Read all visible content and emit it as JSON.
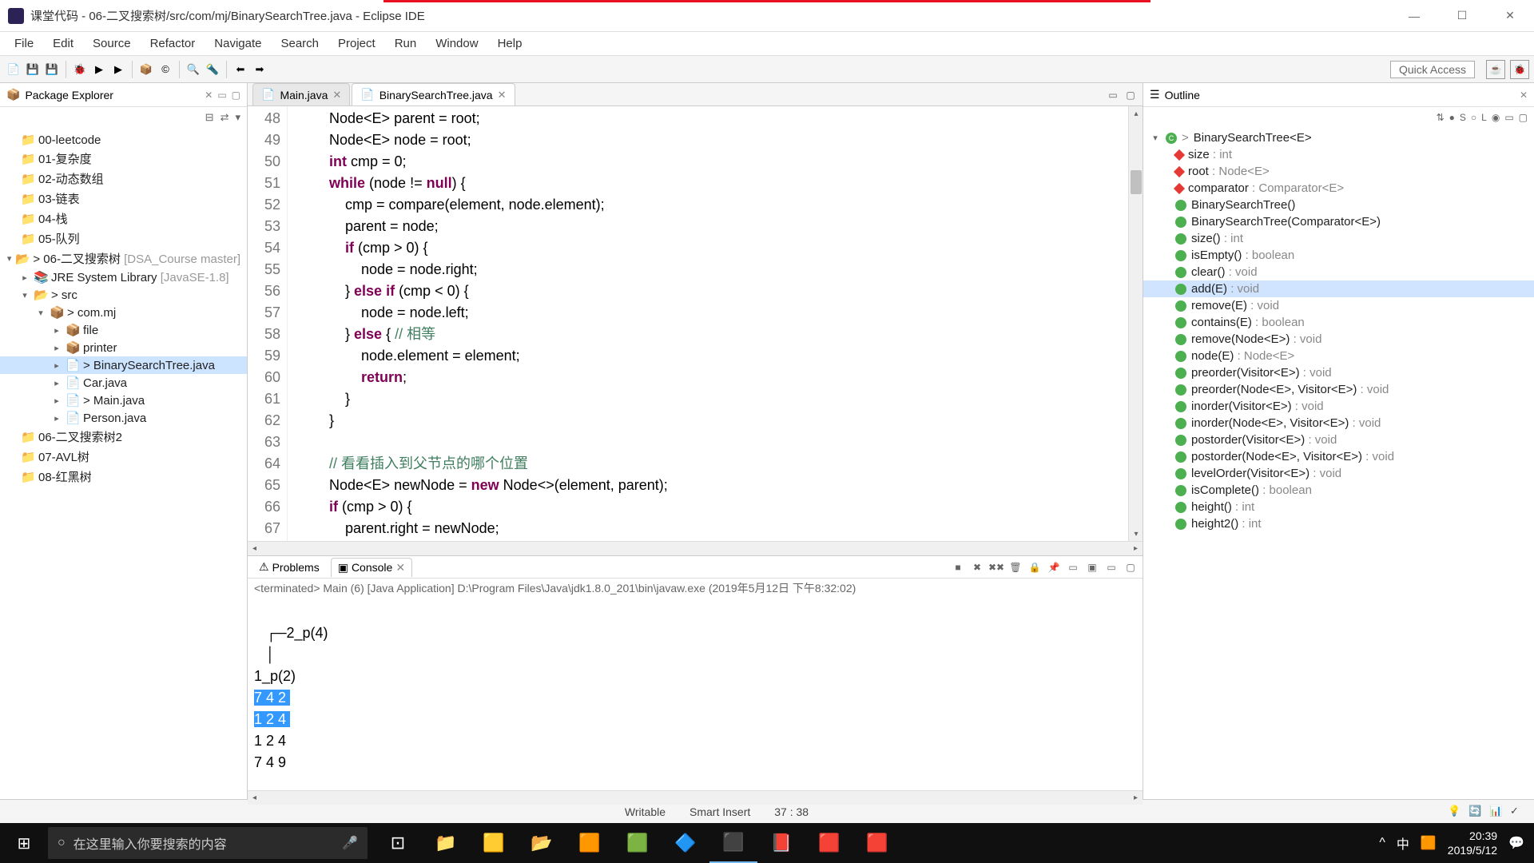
{
  "window": {
    "title": "课堂代码 - 06-二叉搜索树/src/com/mj/BinarySearchTree.java - Eclipse IDE"
  },
  "menu": [
    "File",
    "Edit",
    "Source",
    "Refactor",
    "Navigate",
    "Search",
    "Project",
    "Run",
    "Window",
    "Help"
  ],
  "quickAccess": "Quick Access",
  "packageExplorer": {
    "title": "Package Explorer",
    "items": [
      {
        "label": "00-leetcode",
        "indent": 0,
        "icon": "📁",
        "arrow": ""
      },
      {
        "label": "01-复杂度",
        "indent": 0,
        "icon": "📁",
        "arrow": ""
      },
      {
        "label": "02-动态数组",
        "indent": 0,
        "icon": "📁",
        "arrow": ""
      },
      {
        "label": "03-链表",
        "indent": 0,
        "icon": "📁",
        "arrow": ""
      },
      {
        "label": "04-栈",
        "indent": 0,
        "icon": "📁",
        "arrow": ""
      },
      {
        "label": "05-队列",
        "indent": 0,
        "icon": "📁",
        "arrow": ""
      },
      {
        "label": "> 06-二叉搜索树",
        "suffix": " [DSA_Course master]",
        "indent": 0,
        "icon": "📂",
        "arrow": "▾"
      },
      {
        "label": "JRE System Library",
        "suffix": " [JavaSE-1.8]",
        "indent": 1,
        "icon": "📚",
        "arrow": "▸"
      },
      {
        "label": "> src",
        "indent": 1,
        "icon": "📂",
        "arrow": "▾"
      },
      {
        "label": "> com.mj",
        "indent": 2,
        "icon": "📦",
        "arrow": "▾"
      },
      {
        "label": "file",
        "indent": 3,
        "icon": "📦",
        "arrow": "▸"
      },
      {
        "label": "printer",
        "indent": 3,
        "icon": "📦",
        "arrow": "▸"
      },
      {
        "label": "> BinarySearchTree.java",
        "indent": 3,
        "icon": "📄",
        "arrow": "▸",
        "selected": true
      },
      {
        "label": "Car.java",
        "indent": 3,
        "icon": "📄",
        "arrow": "▸"
      },
      {
        "label": "> Main.java",
        "indent": 3,
        "icon": "📄",
        "arrow": "▸"
      },
      {
        "label": "Person.java",
        "indent": 3,
        "icon": "📄",
        "arrow": "▸"
      },
      {
        "label": "06-二叉搜索树2",
        "indent": 0,
        "icon": "📁",
        "arrow": ""
      },
      {
        "label": "07-AVL树",
        "indent": 0,
        "icon": "📁",
        "arrow": ""
      },
      {
        "label": "08-红黑树",
        "indent": 0,
        "icon": "📁",
        "arrow": ""
      }
    ]
  },
  "editor": {
    "tabs": [
      {
        "label": "Main.java",
        "active": false
      },
      {
        "label": "BinarySearchTree.java",
        "active": true
      }
    ],
    "startLine": 48,
    "lines": [
      {
        "n": 48,
        "html": "        Node&lt;E&gt; parent = root;"
      },
      {
        "n": 49,
        "html": "        Node&lt;E&gt; node = root;"
      },
      {
        "n": 50,
        "html": "        <span class='kw'>int</span> cmp = 0;"
      },
      {
        "n": 51,
        "html": "        <span class='kw'>while</span> (node != <span class='kw'>null</span>) {"
      },
      {
        "n": 52,
        "html": "            cmp = compare(element, node.element);"
      },
      {
        "n": 53,
        "html": "            parent = node;"
      },
      {
        "n": 54,
        "html": "            <span class='kw'>if</span> (cmp &gt; 0) {"
      },
      {
        "n": 55,
        "html": "                node = node.right;"
      },
      {
        "n": 56,
        "html": "            } <span class='kw'>else if</span> (cmp &lt; 0) {"
      },
      {
        "n": 57,
        "html": "                node = node.left;"
      },
      {
        "n": 58,
        "html": "            } <span class='kw'>else</span> { <span class='comment'>// 相等</span>"
      },
      {
        "n": 59,
        "html": "                node.element = element;"
      },
      {
        "n": 60,
        "html": "                <span class='kw'>return</span>;"
      },
      {
        "n": 61,
        "html": "            }"
      },
      {
        "n": 62,
        "html": "        }"
      },
      {
        "n": 63,
        "html": "        "
      },
      {
        "n": 64,
        "html": "        <span class='comment'>// 看看插入到父节点的哪个位置</span>"
      },
      {
        "n": 65,
        "html": "        Node&lt;E&gt; newNode = <span class='kw'>new</span> Node&lt;&gt;(element, parent);"
      },
      {
        "n": 66,
        "html": "        <span class='kw'>if</span> (cmp &gt; 0) {"
      },
      {
        "n": 67,
        "html": "            parent.right = newNode;"
      }
    ]
  },
  "console": {
    "tabs": [
      "Problems",
      "Console"
    ],
    "activeTab": 1,
    "info": "<terminated> Main (6) [Java Application] D:\\Program Files\\Java\\jdk1.8.0_201\\bin\\javaw.exe (2019年5月12日 下午8:32:02)",
    "output": [
      {
        "text": "         ",
        "sel": false
      },
      {
        "text": "   ┌─2_p(4)",
        "sel": false
      },
      {
        "text": "   │",
        "sel": false
      },
      {
        "text": "1_p(2)",
        "sel": false
      },
      {
        "text": "7 4 2 ",
        "sel": true
      },
      {
        "text": "1 2 4 ",
        "sel": true
      },
      {
        "text": "1 2 4 ",
        "sel": false
      },
      {
        "text": "7 4 9 ",
        "sel": false
      }
    ]
  },
  "outline": {
    "title": "Outline",
    "root": "BinarySearchTree<E>",
    "items": [
      {
        "icon": "field",
        "label": "size",
        "ret": " : int"
      },
      {
        "icon": "field",
        "label": "root",
        "ret": " : Node<E>"
      },
      {
        "icon": "field",
        "label": "comparator",
        "ret": " : Comparator<E>"
      },
      {
        "icon": "ctor",
        "label": "BinarySearchTree()"
      },
      {
        "icon": "ctor",
        "label": "BinarySearchTree(Comparator<E>)"
      },
      {
        "icon": "method",
        "label": "size()",
        "ret": " : int"
      },
      {
        "icon": "method",
        "label": "isEmpty()",
        "ret": " : boolean"
      },
      {
        "icon": "method",
        "label": "clear()",
        "ret": " : void"
      },
      {
        "icon": "method",
        "label": "add(E)",
        "ret": " : void",
        "selected": true
      },
      {
        "icon": "method",
        "label": "remove(E)",
        "ret": " : void"
      },
      {
        "icon": "method",
        "label": "contains(E)",
        "ret": " : boolean"
      },
      {
        "icon": "method",
        "label": "remove(Node<E>)",
        "ret": " : void"
      },
      {
        "icon": "method",
        "label": "node(E)",
        "ret": " : Node<E>"
      },
      {
        "icon": "method",
        "label": "preorder(Visitor<E>)",
        "ret": " : void"
      },
      {
        "icon": "method",
        "label": "preorder(Node<E>, Visitor<E>)",
        "ret": " : void"
      },
      {
        "icon": "method",
        "label": "inorder(Visitor<E>)",
        "ret": " : void"
      },
      {
        "icon": "method",
        "label": "inorder(Node<E>, Visitor<E>)",
        "ret": " : void"
      },
      {
        "icon": "method",
        "label": "postorder(Visitor<E>)",
        "ret": " : void"
      },
      {
        "icon": "method",
        "label": "postorder(Node<E>, Visitor<E>)",
        "ret": " : void"
      },
      {
        "icon": "method",
        "label": "levelOrder(Visitor<E>)",
        "ret": " : void"
      },
      {
        "icon": "method",
        "label": "isComplete()",
        "ret": " : boolean"
      },
      {
        "icon": "method",
        "label": "height()",
        "ret": " : int"
      },
      {
        "icon": "method",
        "label": "height2()",
        "ret": " : int"
      }
    ]
  },
  "statusbar": {
    "writable": "Writable",
    "insert": "Smart Insert",
    "pos": "37 : 38"
  },
  "taskbar": {
    "searchPlaceholder": "在这里输入你要搜索的内容",
    "time": "20:39",
    "date": "2019/5/12"
  }
}
